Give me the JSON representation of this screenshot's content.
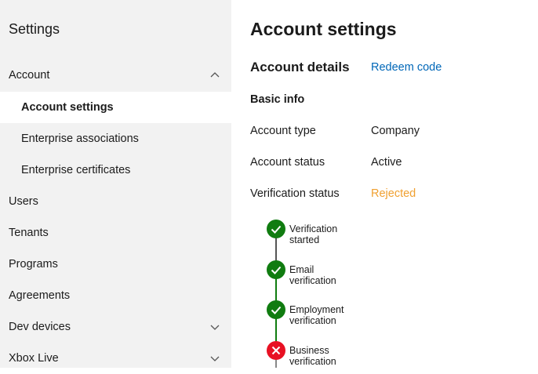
{
  "sidebar": {
    "title": "Settings",
    "items": [
      {
        "label": "Account",
        "chevron": "chevron-up-icon"
      },
      {
        "label": "Account settings",
        "selected": true
      },
      {
        "label": "Enterprise associations"
      },
      {
        "label": "Enterprise certificates"
      },
      {
        "label": "Users"
      },
      {
        "label": "Tenants"
      },
      {
        "label": "Programs"
      },
      {
        "label": "Agreements"
      },
      {
        "label": "Dev devices",
        "chevron": "chevron-down-icon"
      },
      {
        "label": "Xbox Live",
        "chevron": "chevron-down-icon"
      }
    ]
  },
  "main": {
    "title": "Account settings",
    "section_title": "Account details",
    "redeem_link": "Redeem code",
    "basic_info": "Basic info",
    "fields": [
      {
        "label": "Account type",
        "value": "Company"
      },
      {
        "label": "Account status",
        "value": "Active"
      },
      {
        "label": "Verification status",
        "value": "Rejected"
      }
    ],
    "timeline": [
      {
        "label": "Verification started",
        "status": "success"
      },
      {
        "label": "Email verification",
        "status": "success"
      },
      {
        "label": "Employment verification",
        "status": "success"
      },
      {
        "label": "Business verification",
        "status": "failed"
      }
    ]
  },
  "colors": {
    "link": "#0067b8",
    "rejected": "#f0a030",
    "success": "#107c10",
    "failed": "#e81123"
  }
}
